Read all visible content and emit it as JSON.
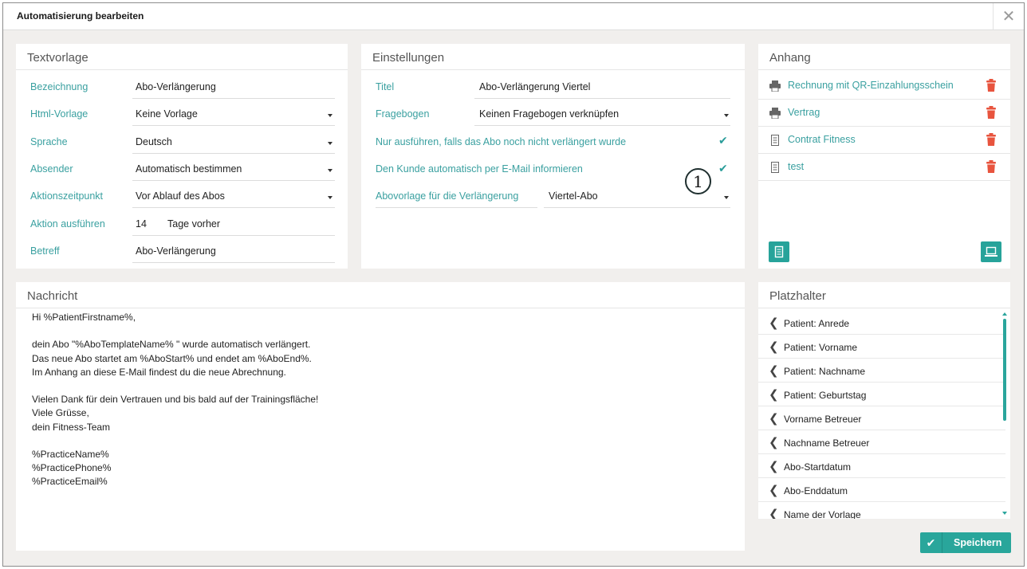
{
  "dialog": {
    "title": "Automatisierung bearbeiten",
    "close_icon": "close-icon"
  },
  "textvorlage": {
    "title": "Textvorlage",
    "fields": [
      {
        "label": "Bezeichnung",
        "value": "Abo-Verlängerung"
      },
      {
        "label": "Html-Vorlage",
        "value": "Keine Vorlage"
      },
      {
        "label": "Sprache",
        "value": "Deutsch"
      },
      {
        "label": "Absender",
        "value": "Automatisch bestimmen"
      },
      {
        "label": "Aktionszeitpunkt",
        "value": "Vor Ablauf des Abos"
      },
      {
        "label": "Aktion ausführen",
        "value": "14",
        "suffix": "Tage vorher"
      },
      {
        "label": "Betreff",
        "value": "Abo-Verlängerung"
      }
    ]
  },
  "einstellungen": {
    "title": "Einstellungen",
    "titel_label": "Titel",
    "titel_value": "Abo-Verlängerung Viertel",
    "fragebogen_label": "Fragebogen",
    "fragebogen_value": "Keinen Fragebogen verknüpfen",
    "checkbox1_label": "Nur ausführen, falls das Abo noch nicht verlängert wurde",
    "checkbox1_checked": true,
    "checkbox2_label": "Den Kunde automatisch per E-Mail informieren",
    "checkbox2_checked": true,
    "abovorlage_label": "Abovorlage für die Verlängerung",
    "abovorlage_value": "Viertel-Abo"
  },
  "anhang": {
    "title": "Anhang",
    "items": [
      {
        "label": "Rechnung mit QR-Einzahlungsschein",
        "icon": "printer-icon"
      },
      {
        "label": "Vertrag",
        "icon": "printer-icon"
      },
      {
        "label": "Contrat Fitness",
        "icon": "document-icon"
      },
      {
        "label": "test",
        "icon": "document-icon"
      }
    ]
  },
  "nachricht": {
    "title": "Nachricht",
    "body": "Hi %PatientFirstname%,\n\ndein Abo \"%AboTemplateName% \" wurde automatisch verlängert.\nDas neue Abo startet am %AboStart% und endet am %AboEnd%.\nIm Anhang an diese E-Mail findest du die neue Abrechnung.\n\nVielen Dank für dein Vertrauen und bis bald auf der Trainingsfläche!\nViele Grüsse,\ndein Fitness-Team\n\n%PracticeName%\n%PracticePhone%\n%PracticeEmail%"
  },
  "platzhalter": {
    "title": "Platzhalter",
    "items": [
      "Patient: Anrede",
      "Patient: Vorname",
      "Patient: Nachname",
      "Patient: Geburtstag",
      "Vorname Betreuer",
      "Nachname Betreuer",
      "Abo-Startdatum",
      "Abo-Enddatum",
      "Name der Vorlage"
    ]
  },
  "footer": {
    "save_label": "Speichern"
  },
  "annotation": {
    "callout_number": "1"
  },
  "colors": {
    "accent": "#27a39a",
    "label": "#3aa0a0",
    "delete": "#e8543e"
  }
}
